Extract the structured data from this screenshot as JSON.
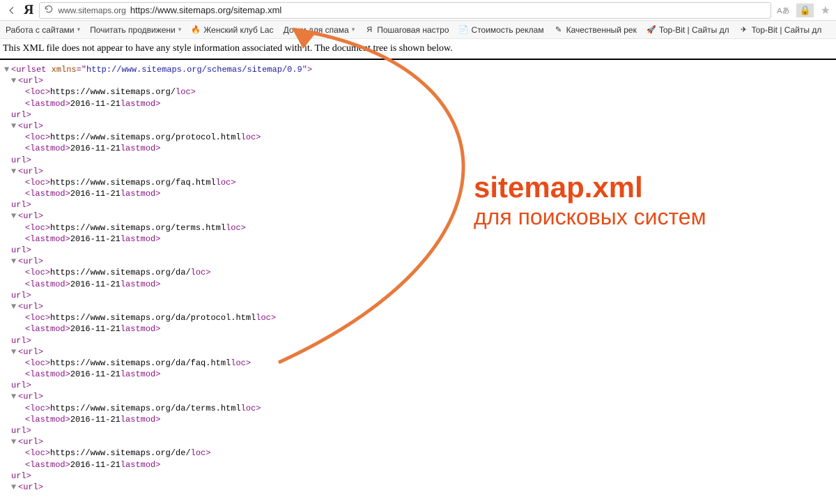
{
  "toolbar": {
    "domain_label": "www.sitemaps.org",
    "url": "https://www.sitemaps.org/sitemap.xml",
    "translate_badge": "Aあ"
  },
  "bookmarks": [
    {
      "label": "Работа с сайтами",
      "icon": "▾"
    },
    {
      "label": "Почитать продвижени",
      "icon": "▾"
    },
    {
      "label": "Женский клуб Lac",
      "icon": "🔥"
    },
    {
      "label": "Доски для спама",
      "icon": "▾"
    },
    {
      "label": "Пошаговая настро",
      "icon": "Я"
    },
    {
      "label": "Стоимость реклам",
      "icon": "📄"
    },
    {
      "label": "Качественный рек",
      "icon": "✎"
    },
    {
      "label": "Top-Bit | Сайты дл",
      "icon": "🚀"
    },
    {
      "label": "Top-Bit | Сайты дл",
      "icon": "✈"
    }
  ],
  "xml_notice": "This XML file does not appear to have any style information associated with it. The document tree is shown below.",
  "xml": {
    "root_open": "<urlset xmlns=\"http://www.sitemaps.org/schemas/sitemap/0.9\">",
    "urls": [
      {
        "loc": "https://www.sitemaps.org/",
        "lastmod": "2016-11-21"
      },
      {
        "loc": "https://www.sitemaps.org/protocol.html",
        "lastmod": "2016-11-21"
      },
      {
        "loc": "https://www.sitemaps.org/faq.html",
        "lastmod": "2016-11-21"
      },
      {
        "loc": "https://www.sitemaps.org/terms.html",
        "lastmod": "2016-11-21"
      },
      {
        "loc": "https://www.sitemaps.org/da/",
        "lastmod": "2016-11-21"
      },
      {
        "loc": "https://www.sitemaps.org/da/protocol.html",
        "lastmod": "2016-11-21"
      },
      {
        "loc": "https://www.sitemaps.org/da/faq.html",
        "lastmod": "2016-11-21"
      },
      {
        "loc": "https://www.sitemaps.org/da/terms.html",
        "lastmod": "2016-11-21"
      },
      {
        "loc": "https://www.sitemaps.org/de/",
        "lastmod": "2016-11-21"
      }
    ]
  },
  "annotation": {
    "title": "sitemap.xml",
    "subtitle": "для поисковых систем"
  }
}
